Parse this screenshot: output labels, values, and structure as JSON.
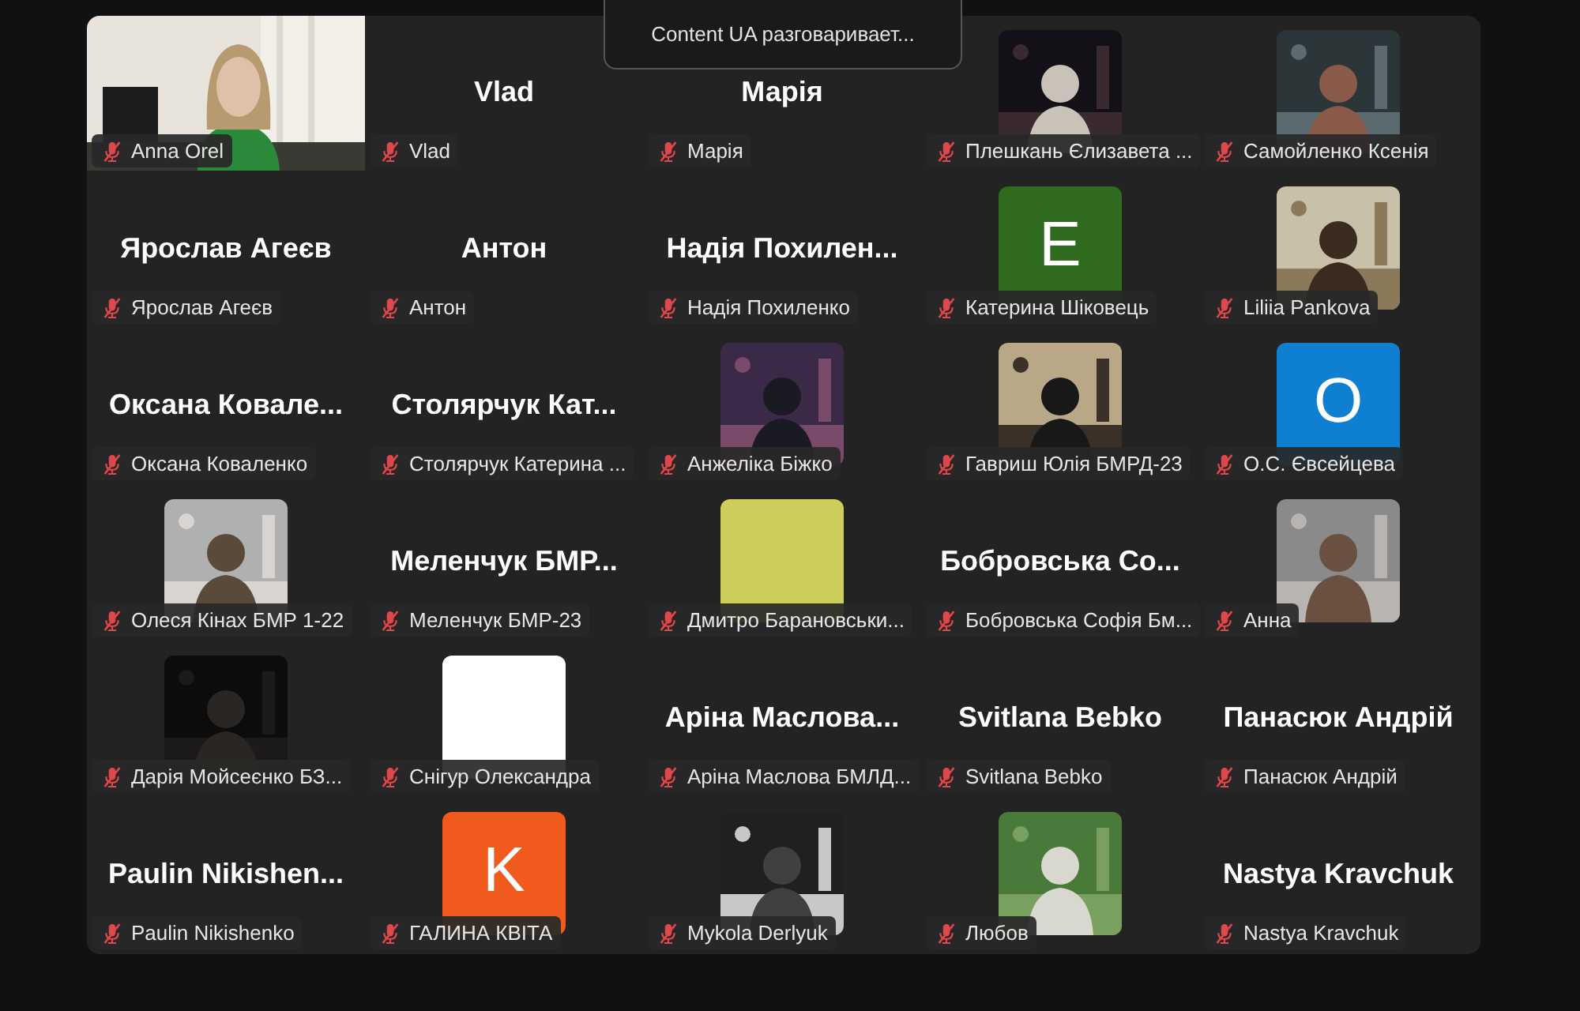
{
  "speaker_banner": "Content UA разговаривает...",
  "tiles": [
    {
      "kind": "video",
      "label": "Anna Orel",
      "muted": true
    },
    {
      "kind": "name",
      "display_name": "Vlad",
      "label": "Vlad",
      "muted": true
    },
    {
      "kind": "name",
      "display_name": "Марія",
      "label": "Марія",
      "muted": true
    },
    {
      "label": "Плешкань Єлизавета ...",
      "muted": true
    },
    {
      "label": "Самойленко Ксенія",
      "muted": true
    },
    {
      "kind": "name",
      "display_name": "Ярослав Агеєв",
      "label": "Ярослав Агеєв",
      "muted": true
    },
    {
      "kind": "name",
      "display_name": "Антон",
      "label": "Антон",
      "muted": true
    },
    {
      "kind": "name",
      "display_name": "Надія  Похилен...",
      "label": "Надія Похиленко",
      "muted": true
    },
    {
      "kind": "avatar",
      "initial": "E",
      "color": "#2e6b1f",
      "label": "Катерина Шіковець",
      "muted": true
    },
    {
      "label": "Liliia Pankova",
      "muted": true
    },
    {
      "kind": "name",
      "display_name": "Оксана  Ковале...",
      "label": "Оксана Коваленко",
      "muted": true
    },
    {
      "kind": "name",
      "display_name": "Столярчук  Кат...",
      "label": "Столярчук Катерина ...",
      "muted": true
    },
    {
      "label": "Анжеліка Біжко",
      "muted": true
    },
    {
      "label": "Гавриш Юлія БМРД-23",
      "muted": true
    },
    {
      "kind": "avatar",
      "initial": "O",
      "color": "#0e7fd1",
      "label": "О.С. Євсейцева",
      "muted": true
    },
    {
      "label": "Олеся Кінах БМР 1-22",
      "muted": true
    },
    {
      "kind": "name",
      "display_name": "Меленчук  БМР...",
      "label": "Меленчук БМР-23",
      "muted": true
    },
    {
      "kind": "avatar",
      "color": "#cdcd5c",
      "label": "Дмитро Барановськи...",
      "muted": true
    },
    {
      "kind": "name",
      "display_name": "Бобровська  Со...",
      "label": "Бобровська Софія Бм...",
      "muted": true
    },
    {
      "label": "Анна",
      "muted": true
    },
    {
      "label": "Дарія Мойсеєнко БЗ...",
      "muted": true
    },
    {
      "kind": "avatar",
      "color": "#ffffff",
      "label": "Снігур Олександра",
      "muted": true
    },
    {
      "kind": "name",
      "display_name": "Аріна  Маслова...",
      "label": "Аріна Маслова БМЛД...",
      "muted": true
    },
    {
      "kind": "name",
      "display_name": "Svitlana Bebko",
      "label": "Svitlana Bebko",
      "muted": true
    },
    {
      "kind": "name",
      "display_name": "Панасюк Андрій",
      "label": "Панасюк Андрій",
      "muted": true
    },
    {
      "kind": "name",
      "display_name": "Paulin  Nikishen...",
      "label": "Paulin Nikishenko",
      "muted": true
    },
    {
      "kind": "avatar",
      "initial": "K",
      "color": "#f05a1c",
      "label": "ГАЛИНА КВІТА",
      "muted": true
    },
    {
      "label": "Mykola Derlyuk",
      "muted": true
    },
    {
      "label": "Любов",
      "muted": true
    },
    {
      "kind": "name",
      "display_name": "Nastya Kravchuk",
      "label": "Nastya Kravchuk",
      "muted": true
    }
  ]
}
